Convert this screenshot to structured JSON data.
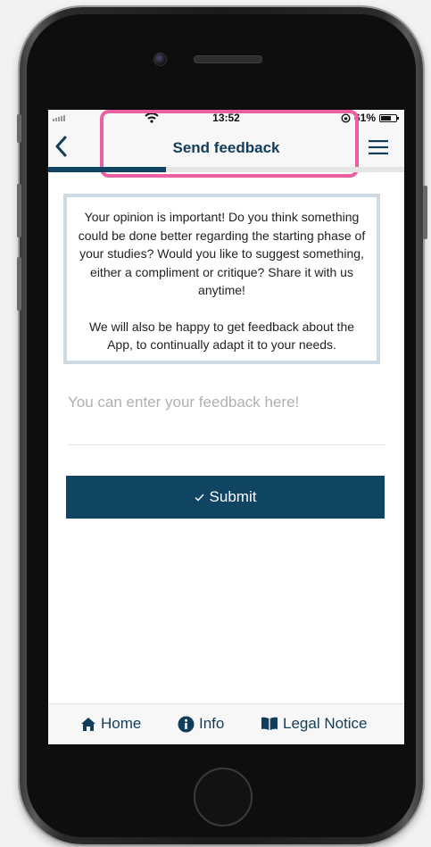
{
  "status_bar": {
    "time": "13:52",
    "battery": "61%"
  },
  "navbar": {
    "title": "Send feedback",
    "back_icon": "chevron-left-icon",
    "menu_icon": "hamburger-menu-icon"
  },
  "progress": {
    "fraction": 0.33
  },
  "info_box": {
    "paragraph1": "Your opinion is important! Do you think something could be done better regarding the starting phase of your studies? Would you like to suggest something, either a compliment or critique? Share it with us anytime!",
    "paragraph2": "We will also be happy to get feedback about the App, to continually adapt it to your needs."
  },
  "feedback": {
    "placeholder": "You can enter your feedback here!",
    "value": ""
  },
  "submit": {
    "label": "Submit",
    "icon": "checkmark-icon"
  },
  "tabbar": {
    "items": [
      {
        "label": "Home",
        "icon": "home-icon"
      },
      {
        "label": "Info",
        "icon": "info-icon"
      },
      {
        "label": "Legal Notice",
        "icon": "book-icon"
      }
    ]
  },
  "colors": {
    "primary": "#0f4463",
    "highlight": "#ec5fa2",
    "info_border": "#cdd9e3"
  }
}
